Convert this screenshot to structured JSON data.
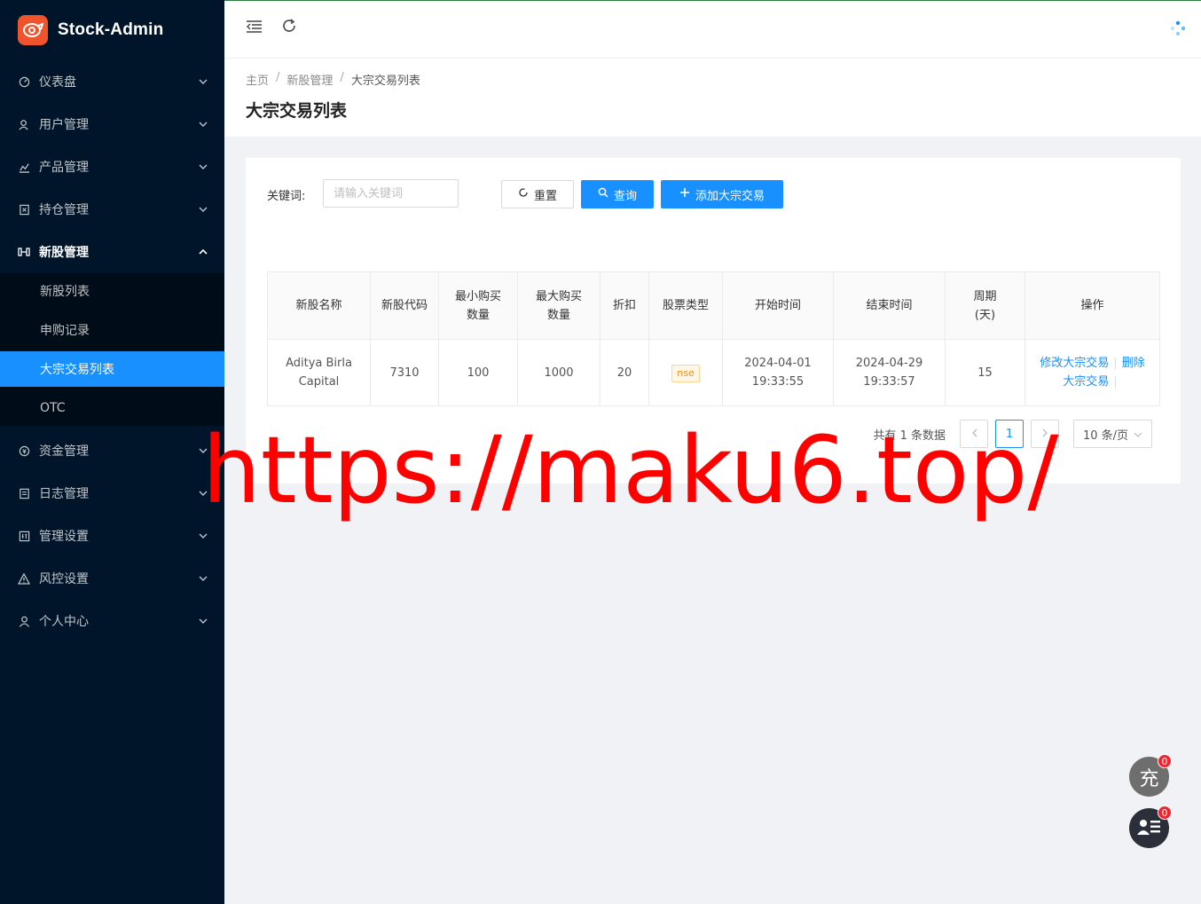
{
  "app": {
    "title": "Stock-Admin"
  },
  "sidebar": {
    "items": [
      {
        "label": "仪表盘",
        "icon": "dashboard-icon"
      },
      {
        "label": "用户管理",
        "icon": "users-icon"
      },
      {
        "label": "产品管理",
        "icon": "chart-icon"
      },
      {
        "label": "持仓管理",
        "icon": "position-icon"
      },
      {
        "label": "新股管理",
        "icon": "ipo-icon",
        "open": true,
        "children": [
          {
            "label": "新股列表"
          },
          {
            "label": "申购记录"
          },
          {
            "label": "大宗交易列表",
            "active": true
          },
          {
            "label": "OTC"
          }
        ]
      },
      {
        "label": "资金管理",
        "icon": "funds-icon"
      },
      {
        "label": "日志管理",
        "icon": "log-icon"
      },
      {
        "label": "管理设置",
        "icon": "settings-icon"
      },
      {
        "label": "风控设置",
        "icon": "risk-icon"
      },
      {
        "label": "个人中心",
        "icon": "user-icon"
      }
    ]
  },
  "breadcrumb": [
    "主页",
    "新股管理",
    "大宗交易列表"
  ],
  "page": {
    "title": "大宗交易列表"
  },
  "search": {
    "label": "关键词:",
    "placeholder": "请输入关键词",
    "value": "",
    "reset_label": "重置",
    "query_label": "查询",
    "add_label": "添加大宗交易"
  },
  "table": {
    "headers": [
      "新股名称",
      "新股代码",
      "最小购买数量",
      "最大购买数量",
      "折扣",
      "股票类型",
      "开始时间",
      "结束时间",
      "周期(天)",
      "操作"
    ],
    "rows": [
      {
        "name": "Aditya Birla Capital",
        "code": "7310",
        "min_qty": "100",
        "max_qty": "1000",
        "discount": "20",
        "type": "nse",
        "start": "2024-04-01 19:33:55",
        "end": "2024-04-29 19:33:57",
        "period": "15",
        "edit_label": "修改大宗交易",
        "delete_label": "删除大宗交易"
      }
    ]
  },
  "pagination": {
    "total_text": "共有 1 条数据",
    "current": "1",
    "page_size": "10 条/页"
  },
  "watermark": "https://maku6.top/",
  "fabs": {
    "recharge_label": "充",
    "recharge_badge": "0",
    "list_badge": "0"
  },
  "colors": {
    "sidebar_bg": "#001529",
    "primary": "#1890ff",
    "logo": "#f0542d",
    "watermark": "#ff0000"
  }
}
